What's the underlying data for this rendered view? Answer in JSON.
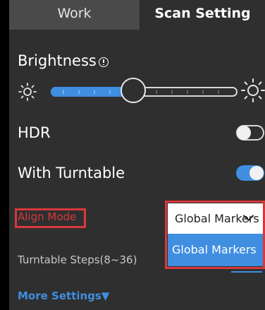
{
  "tabs": {
    "work": "Work",
    "scan_setting": "Scan Setting",
    "active": "Scan Setting"
  },
  "brightness": {
    "label": "Brightness",
    "level_fraction": 0.45
  },
  "hdr": {
    "label": "HDR",
    "enabled": false
  },
  "turntable": {
    "label": "With Turntable",
    "enabled": true
  },
  "align_mode": {
    "label": "Align Mode",
    "selected": "Global Markers",
    "options": [
      "Global Markers"
    ]
  },
  "turntable_steps": {
    "label": "Turntable Steps(8~36)"
  },
  "more_settings": {
    "label": "More Settings▼"
  },
  "colors": {
    "accent": "#3f8ee0",
    "panel": "#2f2f2f",
    "highlight": "#d9383a"
  },
  "icons": {
    "brightness_low": "sun-small-icon",
    "brightness_high": "sun-large-icon",
    "info": "info-icon"
  }
}
